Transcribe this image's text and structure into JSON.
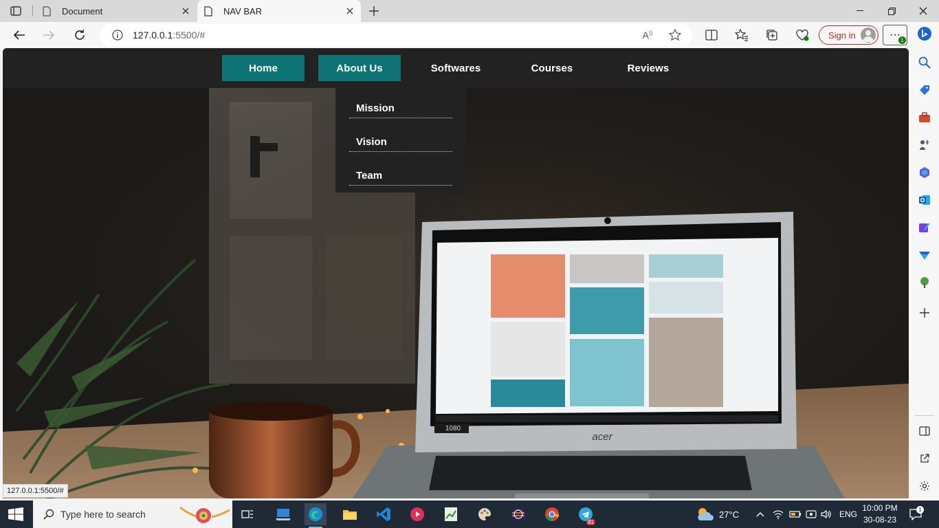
{
  "browser": {
    "tabs": [
      {
        "label": "Document",
        "active": false
      },
      {
        "label": "NAV BAR",
        "active": true
      }
    ],
    "url_host": "127.0.0.1",
    "url_rest": ":5500/#",
    "signin_label": "Sign in",
    "more_badge": "1",
    "status_url": "127.0.0.1:5500/#"
  },
  "site": {
    "nav": [
      {
        "label": "Home",
        "active": true
      },
      {
        "label": "About Us",
        "active": true
      },
      {
        "label": "Softwares",
        "active": false
      },
      {
        "label": "Courses",
        "active": false
      },
      {
        "label": "Reviews",
        "active": false
      }
    ],
    "dropdown": [
      {
        "label": "Mission"
      },
      {
        "label": "Vision"
      },
      {
        "label": "Team"
      }
    ],
    "accent": "#0d7375",
    "nav_bg": "#222222",
    "laptop_brand": "acer",
    "laptop_badge": "1080"
  },
  "taskbar": {
    "search_placeholder": "Type here to search",
    "weather": "27°C",
    "language": "ENG",
    "time": "10:00 PM",
    "date": "30-08-23",
    "telegram_badge": "81",
    "notification_badge": "1"
  }
}
